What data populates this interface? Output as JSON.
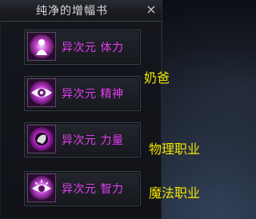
{
  "window": {
    "title": "纯净的增幅书",
    "close_glyph": "×"
  },
  "items": [
    {
      "label": "异次元 体力",
      "icon": "figure-icon"
    },
    {
      "label": "异次元 精神",
      "icon": "eye-icon"
    },
    {
      "label": "异次元 力量",
      "icon": "fist-orb-icon"
    },
    {
      "label": "异次元 智力",
      "icon": "wise-eye-icon"
    }
  ],
  "annotations": [
    "奶爸",
    "物理职业",
    "魔法职业"
  ],
  "colors": {
    "item_text": "#e23df0",
    "annotation_text": "#f2e600",
    "icon_glow": "#c040c8"
  }
}
